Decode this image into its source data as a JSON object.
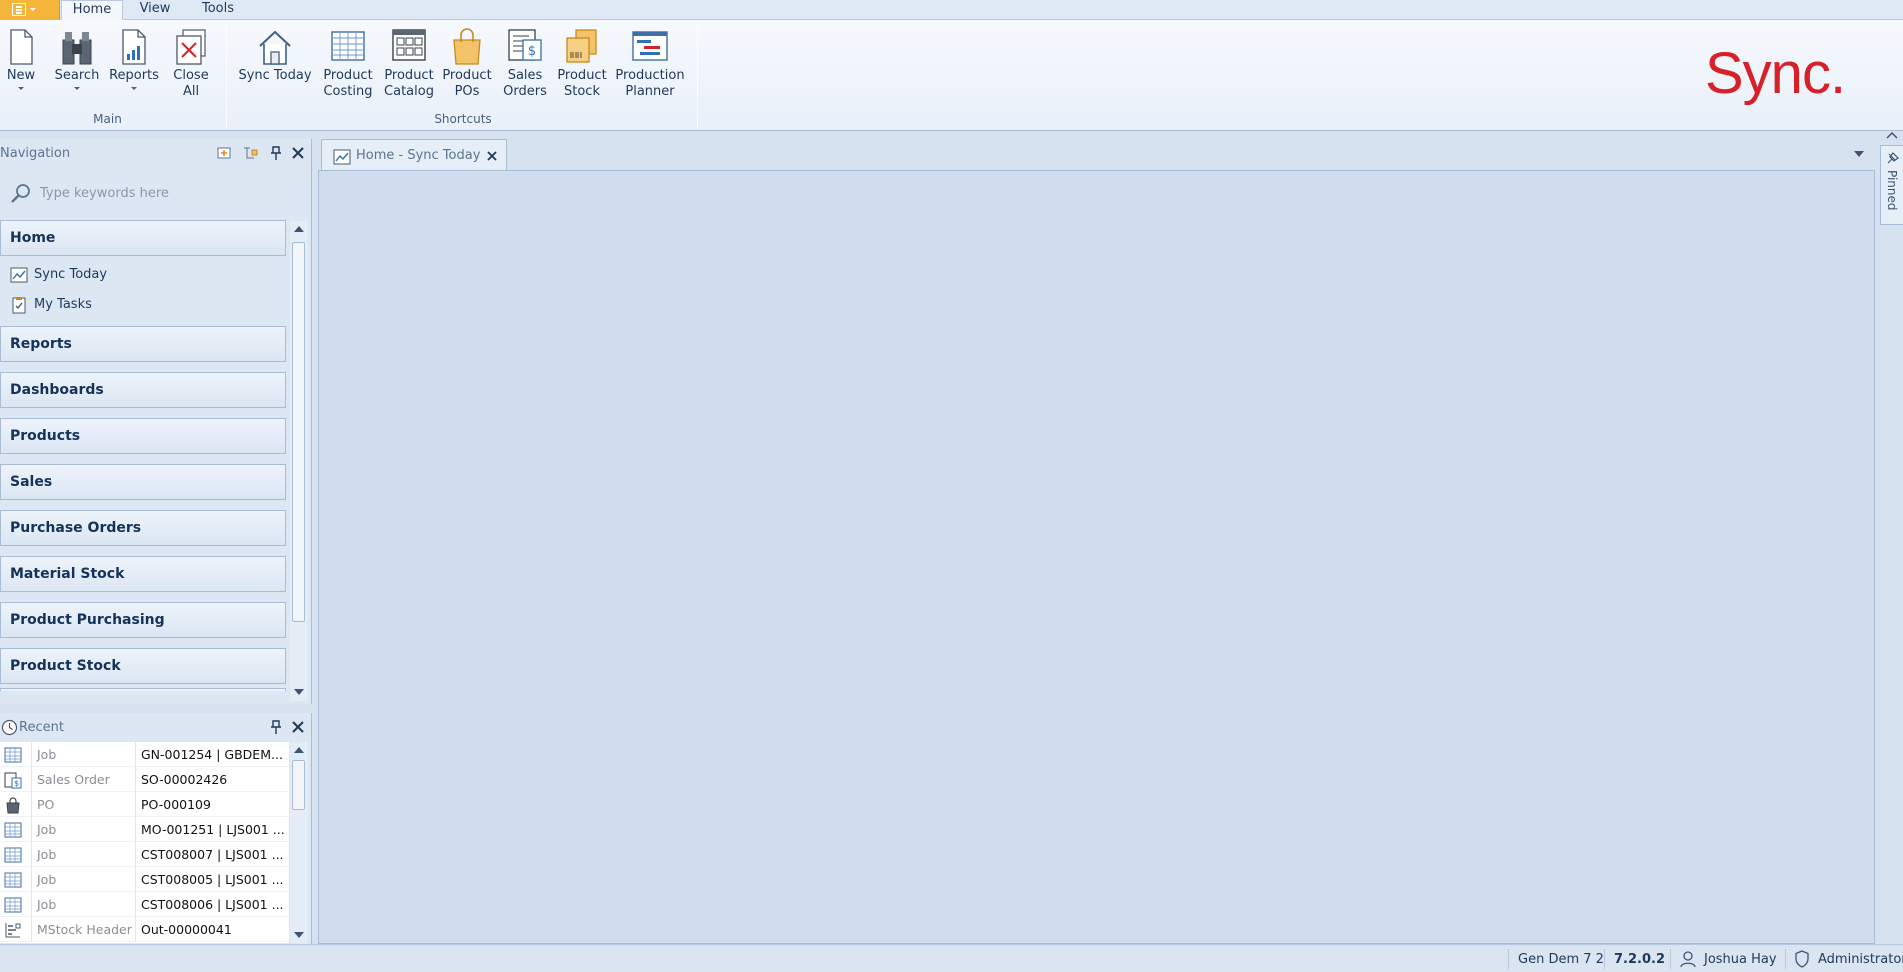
{
  "ribbon": {
    "tabs": [
      {
        "label": "Home",
        "active": true
      },
      {
        "label": "View",
        "active": false
      },
      {
        "label": "Tools",
        "active": false
      }
    ],
    "groups": {
      "main": {
        "label": "Main",
        "buttons": [
          {
            "label": "New",
            "icon": "new-document-icon",
            "has_dropdown": true
          },
          {
            "label": "Search",
            "icon": "binoculars-icon",
            "has_dropdown": true
          },
          {
            "label": "Reports",
            "icon": "report-chart-icon",
            "has_dropdown": true
          },
          {
            "label_line1": "Close",
            "label_line2": "All",
            "icon": "close-all-icon"
          }
        ]
      },
      "shortcuts": {
        "label": "Shortcuts",
        "buttons": [
          {
            "label_line1": "Sync Today",
            "label_line2": "",
            "icon": "home-icon"
          },
          {
            "label_line1": "Product",
            "label_line2": "Costing",
            "icon": "grid-sheet-icon"
          },
          {
            "label_line1": "Product",
            "label_line2": "Catalog",
            "icon": "catalog-icon"
          },
          {
            "label_line1": "Product",
            "label_line2": "POs",
            "icon": "shopping-bag-icon"
          },
          {
            "label_line1": "Sales",
            "label_line2": "Orders",
            "icon": "sales-order-icon"
          },
          {
            "label_line1": "Product",
            "label_line2": "Stock",
            "icon": "stock-boxes-icon"
          },
          {
            "label_line1": "Production",
            "label_line2": "Planner",
            "icon": "planner-gantt-icon"
          }
        ]
      }
    },
    "brand": "Sync."
  },
  "navigation": {
    "title": "Navigation",
    "search_placeholder": "Type keywords here",
    "groups": [
      {
        "label": "Home",
        "items": [
          {
            "label": "Sync Today",
            "icon": "chart-window-icon"
          },
          {
            "label": "My Tasks",
            "icon": "clipboard-check-icon"
          }
        ]
      },
      {
        "label": "Reports"
      },
      {
        "label": "Dashboards"
      },
      {
        "label": "Products"
      },
      {
        "label": "Sales"
      },
      {
        "label": "Purchase Orders"
      },
      {
        "label": "Material Stock"
      },
      {
        "label": "Product Purchasing"
      },
      {
        "label": "Product Stock"
      }
    ]
  },
  "recent": {
    "title": "Recent",
    "rows": [
      {
        "type": "Job",
        "value": "GN-001254 | GBDEM...",
        "icon": "grid-sheet-icon"
      },
      {
        "type": "Sales Order",
        "value": "SO-00002426",
        "icon": "sales-order-icon"
      },
      {
        "type": "PO",
        "value": "PO-000109",
        "icon": "shopping-bag-icon"
      },
      {
        "type": "Job",
        "value": "MO-001251 | LJS001 ...",
        "icon": "grid-sheet-icon"
      },
      {
        "type": "Job",
        "value": "CST008007 | LJS001 ...",
        "icon": "grid-sheet-icon"
      },
      {
        "type": "Job",
        "value": "CST008005 | LJS001 ...",
        "icon": "grid-sheet-icon"
      },
      {
        "type": "Job",
        "value": "CST008006 | LJS001 ...",
        "icon": "grid-sheet-icon"
      },
      {
        "type": "MStock Header",
        "value": "Out-00000041",
        "icon": "stock-header-icon"
      }
    ]
  },
  "document": {
    "tab_label": "Home - Sync Today"
  },
  "pinned_label": "Pinned",
  "status": {
    "database": "Gen Dem 7 2",
    "version": "7.2.0.2",
    "user": "Joshua Hay",
    "role": "Administrator"
  },
  "colors": {
    "brand_red": "#d6202a",
    "app_button": "#f5b53b",
    "accent_blue": "#1e395b"
  }
}
